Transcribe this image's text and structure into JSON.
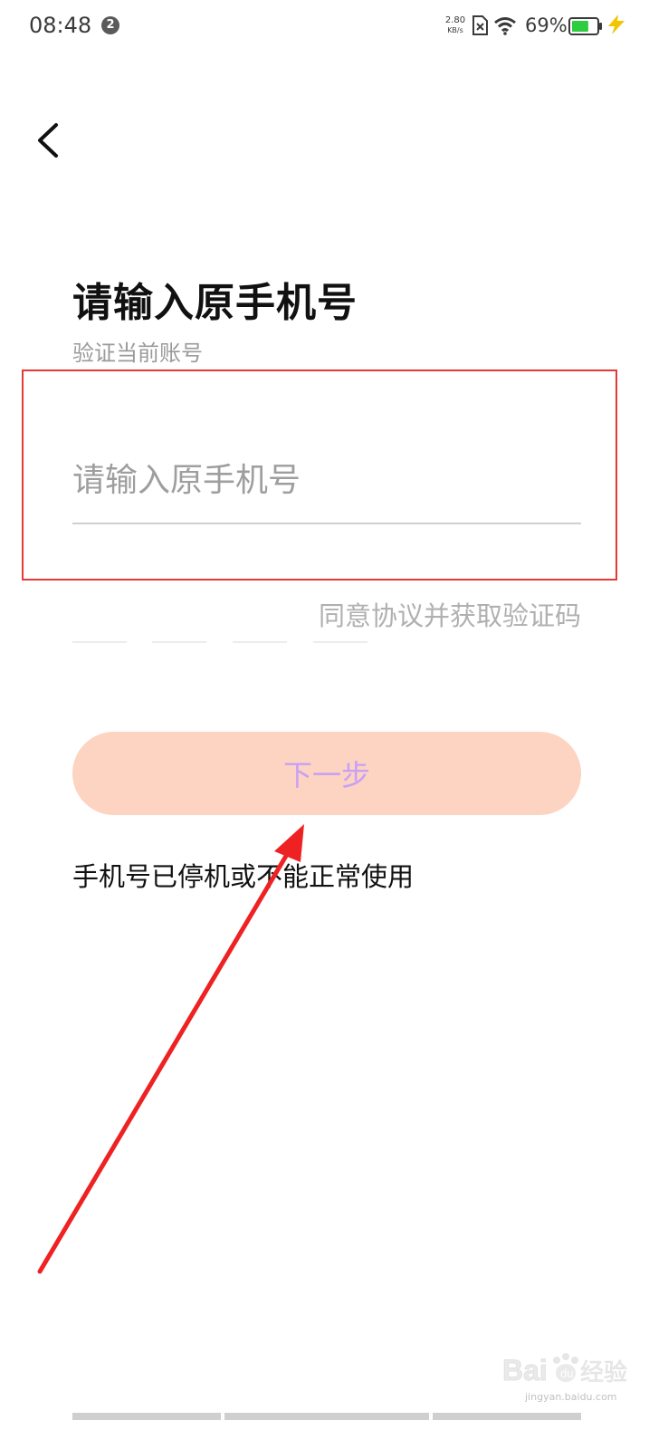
{
  "status_bar": {
    "time": "08:48",
    "notification_count": "2",
    "net_speed_value": "2.80",
    "net_speed_unit": "KB/s",
    "battery_percent": "69%",
    "battery_level": 0.69,
    "battery_color": "#2ecc40",
    "charge_color": "#f2c500"
  },
  "header": {
    "back_icon": "chevron-left-icon"
  },
  "main": {
    "title": "请输入原手机号",
    "subtitle": "验证当前账号",
    "phone_input": {
      "value": "",
      "placeholder": "请输入原手机号"
    },
    "get_code_label": "同意协议并获取验证码",
    "next_button_label": "下一步",
    "next_button_bg": "#fdd3c1",
    "next_button_text_color": "#c8a0f5",
    "stopped_link_label": "手机号已停机或不能正常使用"
  },
  "annotation": {
    "highlight_color": "#e53935",
    "arrow_color": "#ee2222"
  },
  "watermark": {
    "brand": "Bai du 经验",
    "url": "jingyan.baidu.com"
  }
}
